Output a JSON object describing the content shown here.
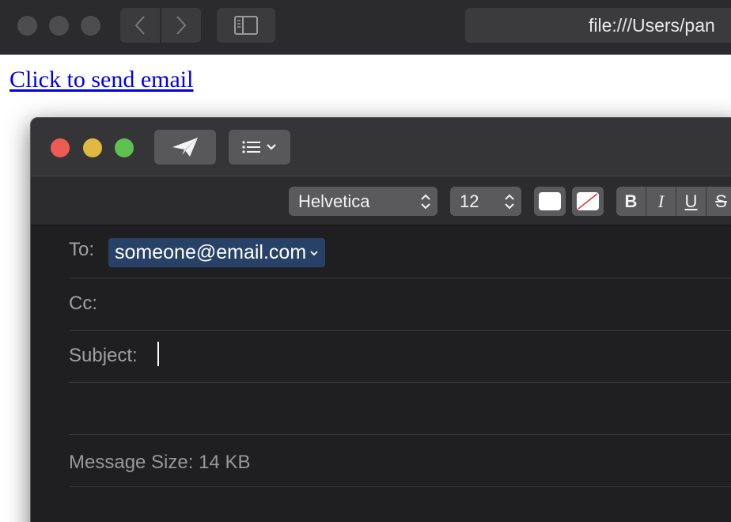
{
  "browser": {
    "url": "file:///Users/pan"
  },
  "page": {
    "link_text": "Click to send email"
  },
  "compose": {
    "font_name": "Helvetica",
    "font_size": "12",
    "style_buttons": {
      "bold": "B",
      "italic": "I",
      "underline": "U",
      "strike": "S"
    },
    "to_label": "To:",
    "to_recipient": "someone@email.com",
    "cc_label": "Cc:",
    "subject_label": "Subject:",
    "message_size": "Message Size: 14 KB"
  },
  "colors": {
    "accent_token": "#284267",
    "link": "#0000ee",
    "close": "#ee5b55",
    "minimize": "#e1b942",
    "zoom": "#5fc14d"
  }
}
